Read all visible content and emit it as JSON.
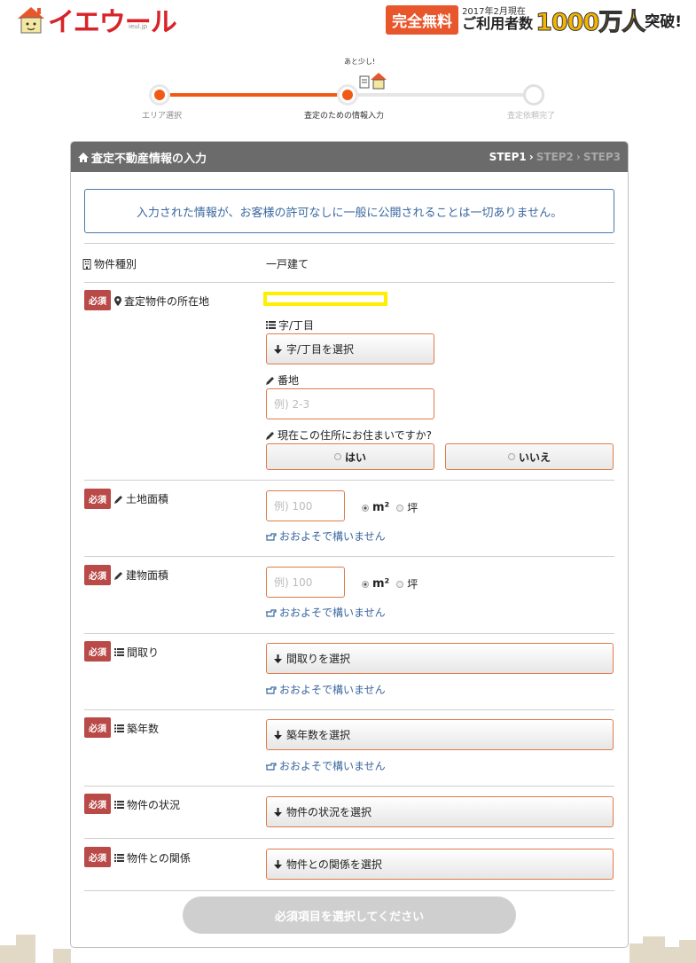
{
  "header": {
    "logo_text": "イエウール",
    "logo_sub": "ieul.jp",
    "free_badge": "完全無料",
    "promo_small": "2017年2月現在",
    "promo_users": "ご利用者数",
    "promo_number": "1000万人",
    "promo_end": "突破!"
  },
  "progress": {
    "bubble": "あと少し!",
    "steps": [
      {
        "label": "エリア選択"
      },
      {
        "label": "査定のための情報入力"
      },
      {
        "label": "査定依頼完了"
      }
    ]
  },
  "panel": {
    "title": "査定不動産情報の入力",
    "step1": "STEP1",
    "step2": "STEP2",
    "step3": "STEP3",
    "sep": "›"
  },
  "notice": "入力された情報が、お客様の許可なしに一般に公開されることは一切ありません。",
  "required_badge": "必須",
  "property_type": {
    "label": "物件種別",
    "value": "一戸建て"
  },
  "location": {
    "label": "査定物件の所在地",
    "chome_label": "字/丁目",
    "chome_select": "字/丁目を選択",
    "banchi_label": "番地",
    "banchi_placeholder": "例) 2-3",
    "living_label": "現在この住所にお住まいですか?",
    "yes": "はい",
    "no": "いいえ"
  },
  "land_area": {
    "label": "土地面積",
    "placeholder": "例) 100",
    "unit_m2": "m²",
    "unit_tsubo": "坪",
    "hint": "おおよそで構いません"
  },
  "building_area": {
    "label": "建物面積",
    "placeholder": "例) 100",
    "unit_m2": "m²",
    "unit_tsubo": "坪",
    "hint": "おおよそで構いません"
  },
  "layout": {
    "label": "間取り",
    "select": "間取りを選択",
    "hint": "おおよそで構いません"
  },
  "age": {
    "label": "築年数",
    "select": "築年数を選択",
    "hint": "おおよそで構いません"
  },
  "status": {
    "label": "物件の状況",
    "select": "物件の状況を選択"
  },
  "relation": {
    "label": "物件との関係",
    "select": "物件との関係を選択"
  },
  "submit": "必須項目を選択してください",
  "colors": {
    "accent": "#f05a14",
    "required": "#b94a48",
    "link": "#3a68a0",
    "header_bar": "#6b6b6b"
  }
}
